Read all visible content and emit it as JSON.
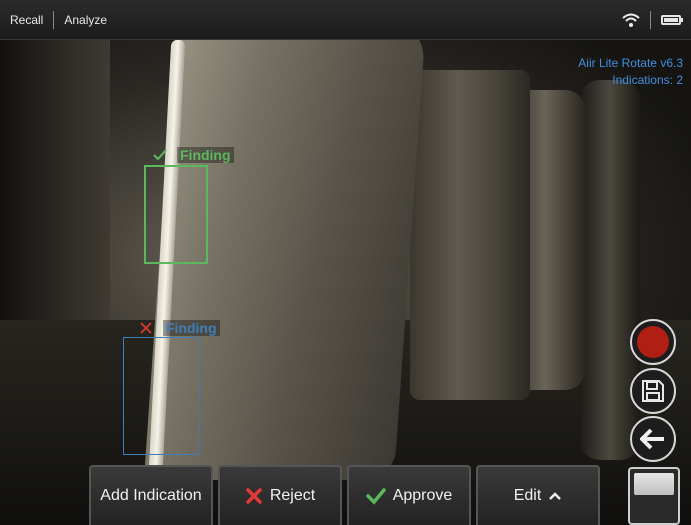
{
  "topbar": {
    "recall": "Recall",
    "analyze": "Analyze"
  },
  "info": {
    "app_version": "Aiir Lite Rotate v6.3",
    "indications": "Indications: 2"
  },
  "findings": [
    {
      "label": "Finding",
      "status": "approved",
      "color": "#5cb85c"
    },
    {
      "label": "Finding",
      "status": "rejected",
      "color": "#3f7fb8"
    }
  ],
  "icons": {
    "wifi": "wifi-icon",
    "battery": "battery-icon",
    "record": "record-icon",
    "save": "save-icon",
    "back": "back-arrow-icon",
    "reject": "x-icon",
    "approve": "check-icon",
    "edit": "chevron-up-icon"
  },
  "buttons": {
    "add_indication": "Add Indication",
    "reject": "Reject",
    "approve": "Approve",
    "edit": "Edit"
  },
  "colors": {
    "reject": "#e53935",
    "approve": "#5cb85c",
    "info": "#3f8fe0",
    "record": "#b01e14"
  }
}
